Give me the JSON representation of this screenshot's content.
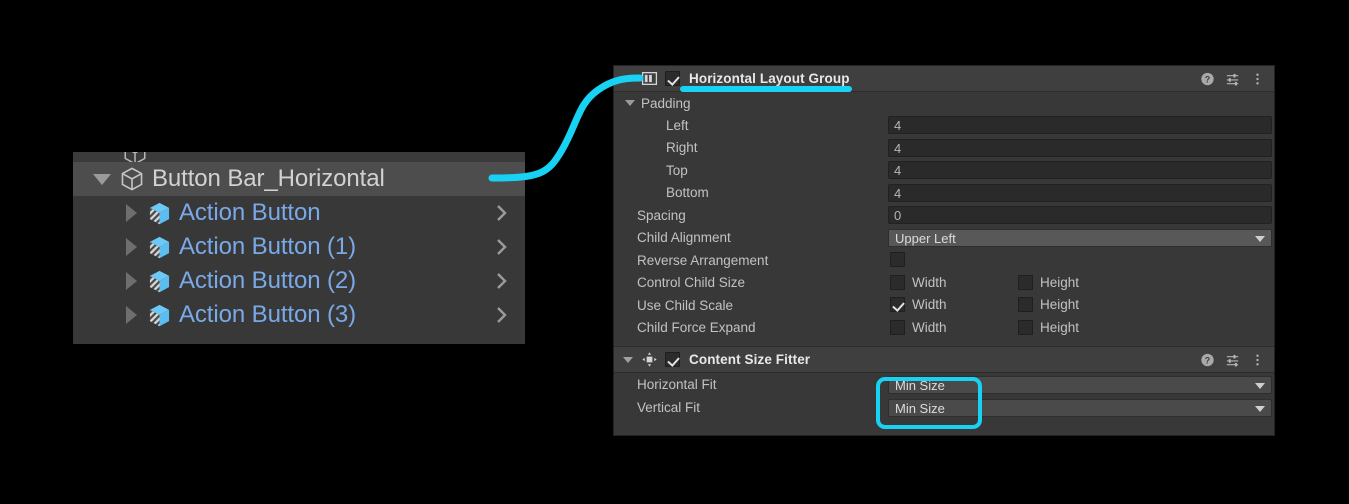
{
  "accent_color": "#17d2f2",
  "hierarchy": {
    "root": {
      "label": "Button Bar_Horizontal",
      "icon": "gameobject-cube-icon",
      "foldout": "expanded"
    },
    "children": [
      {
        "label": "Action Button",
        "icon": "prefab-variant-cube-icon",
        "open_chevron": "›"
      },
      {
        "label": "Action Button (1)",
        "icon": "prefab-variant-cube-icon",
        "open_chevron": "›"
      },
      {
        "label": "Action Button (2)",
        "icon": "prefab-variant-cube-icon",
        "open_chevron": "›"
      },
      {
        "label": "Action Button (3)",
        "icon": "prefab-variant-cube-icon",
        "open_chevron": "›"
      }
    ]
  },
  "inspector": {
    "components": [
      {
        "title": "Horizontal Layout Group",
        "icon": "horizontal-layout-group-icon",
        "enabled": true,
        "highlighted": true,
        "header_icons": [
          "help-icon",
          "preset-icon",
          "more-menu-icon"
        ],
        "foldouts": [
          {
            "label": "Padding",
            "expanded": true,
            "fields": [
              {
                "label": "Left",
                "type": "text",
                "value": "4"
              },
              {
                "label": "Right",
                "type": "text",
                "value": "4"
              },
              {
                "label": "Top",
                "type": "text",
                "value": "4"
              },
              {
                "label": "Bottom",
                "type": "text",
                "value": "4"
              }
            ]
          }
        ],
        "fields": [
          {
            "label": "Spacing",
            "type": "text",
            "value": "0"
          },
          {
            "label": "Child Alignment",
            "type": "dropdown",
            "value": "Upper Left"
          },
          {
            "label": "Reverse Arrangement",
            "type": "checkbox",
            "checked": false
          },
          {
            "label": "Control Child Size",
            "type": "checkbox-pair",
            "width_label": "Width",
            "width_checked": false,
            "height_label": "Height",
            "height_checked": false
          },
          {
            "label": "Use Child Scale",
            "type": "checkbox-pair",
            "width_label": "Width",
            "width_checked": true,
            "height_label": "Height",
            "height_checked": false
          },
          {
            "label": "Child Force Expand",
            "type": "checkbox-pair",
            "width_label": "Width",
            "width_checked": false,
            "height_label": "Height",
            "height_checked": false
          }
        ]
      },
      {
        "title": "Content Size Fitter",
        "icon": "content-size-fitter-icon",
        "enabled": true,
        "highlighted": false,
        "header_icons": [
          "help-icon",
          "preset-icon",
          "more-menu-icon"
        ],
        "foldouts": [],
        "fields": [
          {
            "label": "Horizontal Fit",
            "type": "dropdown-dark",
            "value": "Min Size"
          },
          {
            "label": "Vertical Fit",
            "type": "dropdown-dark",
            "value": "Min Size"
          }
        ]
      }
    ]
  },
  "annotations": {
    "connector": "cyan-curve-connector",
    "title_underline": "cyan-underline",
    "highlight_box": "cyan-highlight-box"
  }
}
